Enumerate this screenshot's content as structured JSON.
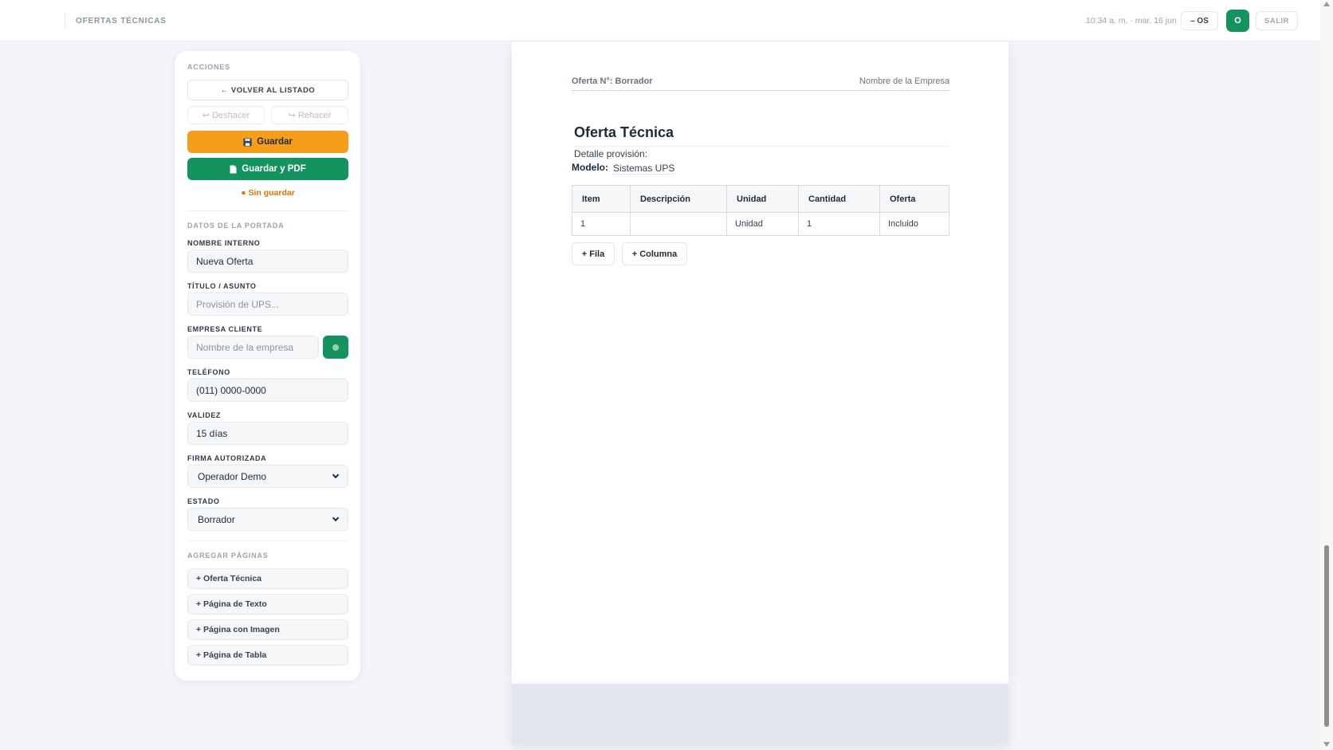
{
  "topbar": {
    "app_title": "OFERTAS TÉCNICAS",
    "datetime": "10:34 a. m. · mar, 16 jun",
    "user_chip": "– OS",
    "avatar_initial": "O",
    "logout": "SALIR"
  },
  "sidebar": {
    "actions_title": "ACCIONES",
    "back_label": "← VOLVER AL LISTADO",
    "undo_label": "Deshacer",
    "redo_label": "Rehacer",
    "save_label": "Guardar",
    "save_pdf_label": "Guardar y PDF",
    "status_text": "● Sin guardar",
    "cover_title": "DATOS DE LA PORTADA",
    "fields": {
      "internal_name": {
        "label": "NOMBRE INTERNO",
        "value": "Nueva Oferta"
      },
      "title": {
        "label": "TÍTULO / ASUNTO",
        "placeholder": "Provisión de UPS..."
      },
      "client": {
        "label": "EMPRESA CLIENTE",
        "placeholder": "Nombre de la empresa"
      },
      "phone": {
        "label": "TELÉFONO",
        "value": "(011) 0000-0000"
      },
      "validity": {
        "label": "VALIDEZ",
        "value": "15 días"
      },
      "signature": {
        "label": "FIRMA AUTORIZADA",
        "value": "Operador Demo"
      },
      "state": {
        "label": "ESTADO",
        "value": "Borrador"
      }
    },
    "add_pages_title": "AGREGAR PÁGINAS",
    "add_pages": [
      "+ Oferta Técnica",
      "+ Página de Texto",
      "+ Página con Imagen",
      "+ Página de Tabla"
    ]
  },
  "document": {
    "offer_number": "Oferta N°: Borrador",
    "company_name": "Nombre de la Empresa",
    "title": "Oferta Técnica",
    "detail_label": "Detalle provisión:",
    "model_label": "Modelo:",
    "model_value": "Sistemas UPS",
    "table": {
      "headers": [
        "Item",
        "Descripción",
        "Unidad",
        "Cantidad",
        "Oferta"
      ],
      "rows": [
        [
          "1",
          "",
          "Unidad",
          "1",
          "Incluido"
        ]
      ]
    },
    "add_row": "+ Fila",
    "add_column": "+ Columna"
  },
  "colors": {
    "accent_green": "#14935f",
    "accent_orange": "#f49e1a",
    "status_orange": "#d97706"
  }
}
